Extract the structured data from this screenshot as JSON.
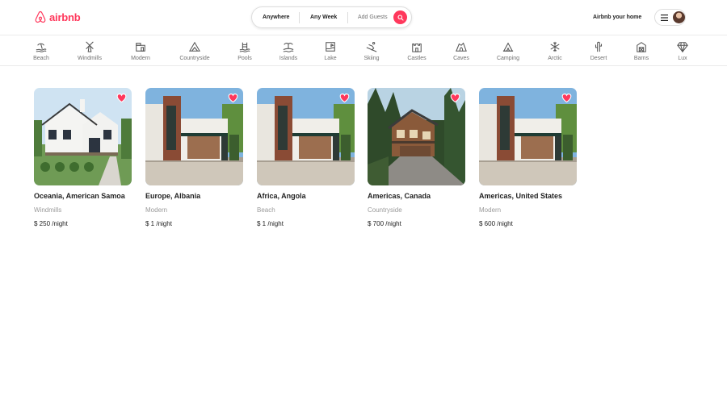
{
  "header": {
    "logo_text": "airbnb",
    "search": {
      "anywhere": "Anywhere",
      "week": "Any Week",
      "guests": "Add Guests"
    },
    "host_link": "Airbnb your home"
  },
  "categories": [
    {
      "label": "Beach",
      "icon": "beach-icon"
    },
    {
      "label": "Windmills",
      "icon": "windmill-icon"
    },
    {
      "label": "Modern",
      "icon": "modern-house-icon"
    },
    {
      "label": "Countryside",
      "icon": "countryside-icon"
    },
    {
      "label": "Pools",
      "icon": "pool-icon"
    },
    {
      "label": "Islands",
      "icon": "island-icon"
    },
    {
      "label": "Lake",
      "icon": "lake-icon"
    },
    {
      "label": "Skiing",
      "icon": "skiing-icon"
    },
    {
      "label": "Castles",
      "icon": "castle-icon"
    },
    {
      "label": "Caves",
      "icon": "cave-icon"
    },
    {
      "label": "Camping",
      "icon": "camping-icon"
    },
    {
      "label": "Arctic",
      "icon": "snowflake-icon"
    },
    {
      "label": "Desert",
      "icon": "cactus-icon"
    },
    {
      "label": "Barns",
      "icon": "barn-icon"
    },
    {
      "label": "Lux",
      "icon": "diamond-icon"
    }
  ],
  "listings": [
    {
      "title": "Oceania, American Samoa",
      "category": "Windmills",
      "price": "$ 250",
      "per": "/night",
      "photo": "white-farmhouse"
    },
    {
      "title": "Europe, Albania",
      "category": "Modern",
      "price": "$ 1",
      "per": "/night",
      "photo": "modern-house"
    },
    {
      "title": "Africa, Angola",
      "category": "Beach",
      "price": "$ 1",
      "per": "/night",
      "photo": "modern-house"
    },
    {
      "title": "Americas, Canada",
      "category": "Countryside",
      "price": "$ 700",
      "per": "/night",
      "photo": "forest-lodge"
    },
    {
      "title": "Americas, United States",
      "category": "Modern",
      "price": "$ 600",
      "per": "/night",
      "photo": "modern-house"
    }
  ],
  "colors": {
    "brand": "#ff385c",
    "muted": "#717171",
    "border": "#dddddd"
  }
}
